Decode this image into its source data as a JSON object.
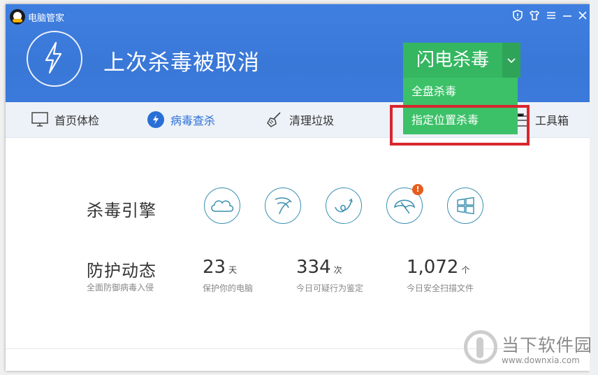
{
  "window": {
    "title": "电脑管家"
  },
  "titlebar": {
    "controls": [
      "shield-icon",
      "shirt-icon",
      "menu-icon",
      "minimize-icon",
      "close-icon"
    ]
  },
  "header": {
    "status": "上次杀毒被取消",
    "scan_button": "闪电杀毒",
    "dropdown": [
      {
        "label": "全盘杀毒"
      },
      {
        "label": "指定位置杀毒"
      }
    ]
  },
  "nav": {
    "items": [
      {
        "label": "首页体检",
        "icon": "monitor-icon"
      },
      {
        "label": "病毒查杀",
        "icon": "lightning-icon",
        "active": true
      },
      {
        "label": "清理垃圾",
        "icon": "broom-icon"
      },
      {
        "label": "工具箱",
        "icon": "toolbox-icon"
      }
    ]
  },
  "engine": {
    "title": "杀毒引擎",
    "icons": [
      "cloud-engine-icon",
      "sail-engine-icon",
      "behavior-engine-icon",
      "umbrella-engine-icon",
      "windows-engine-icon"
    ],
    "warning": "!"
  },
  "protection": {
    "title": "防护动态",
    "subtitle": "全面防御病毒入侵",
    "stats": [
      {
        "value": "23",
        "unit": "天",
        "label": "保护你的电脑"
      },
      {
        "value": "334",
        "unit": "次",
        "label": "今日可疑行为鉴定"
      },
      {
        "value": "1,072",
        "unit": "个",
        "label": "今日安全扫描文件"
      }
    ]
  },
  "watermark": {
    "name": "当下软件园",
    "url": "www.downxia.com"
  },
  "colors": {
    "header_blue": "#3b79da",
    "scan_green": "#35b661",
    "highlight_red": "#d9262e",
    "nav_active": "#2a6fd6"
  }
}
